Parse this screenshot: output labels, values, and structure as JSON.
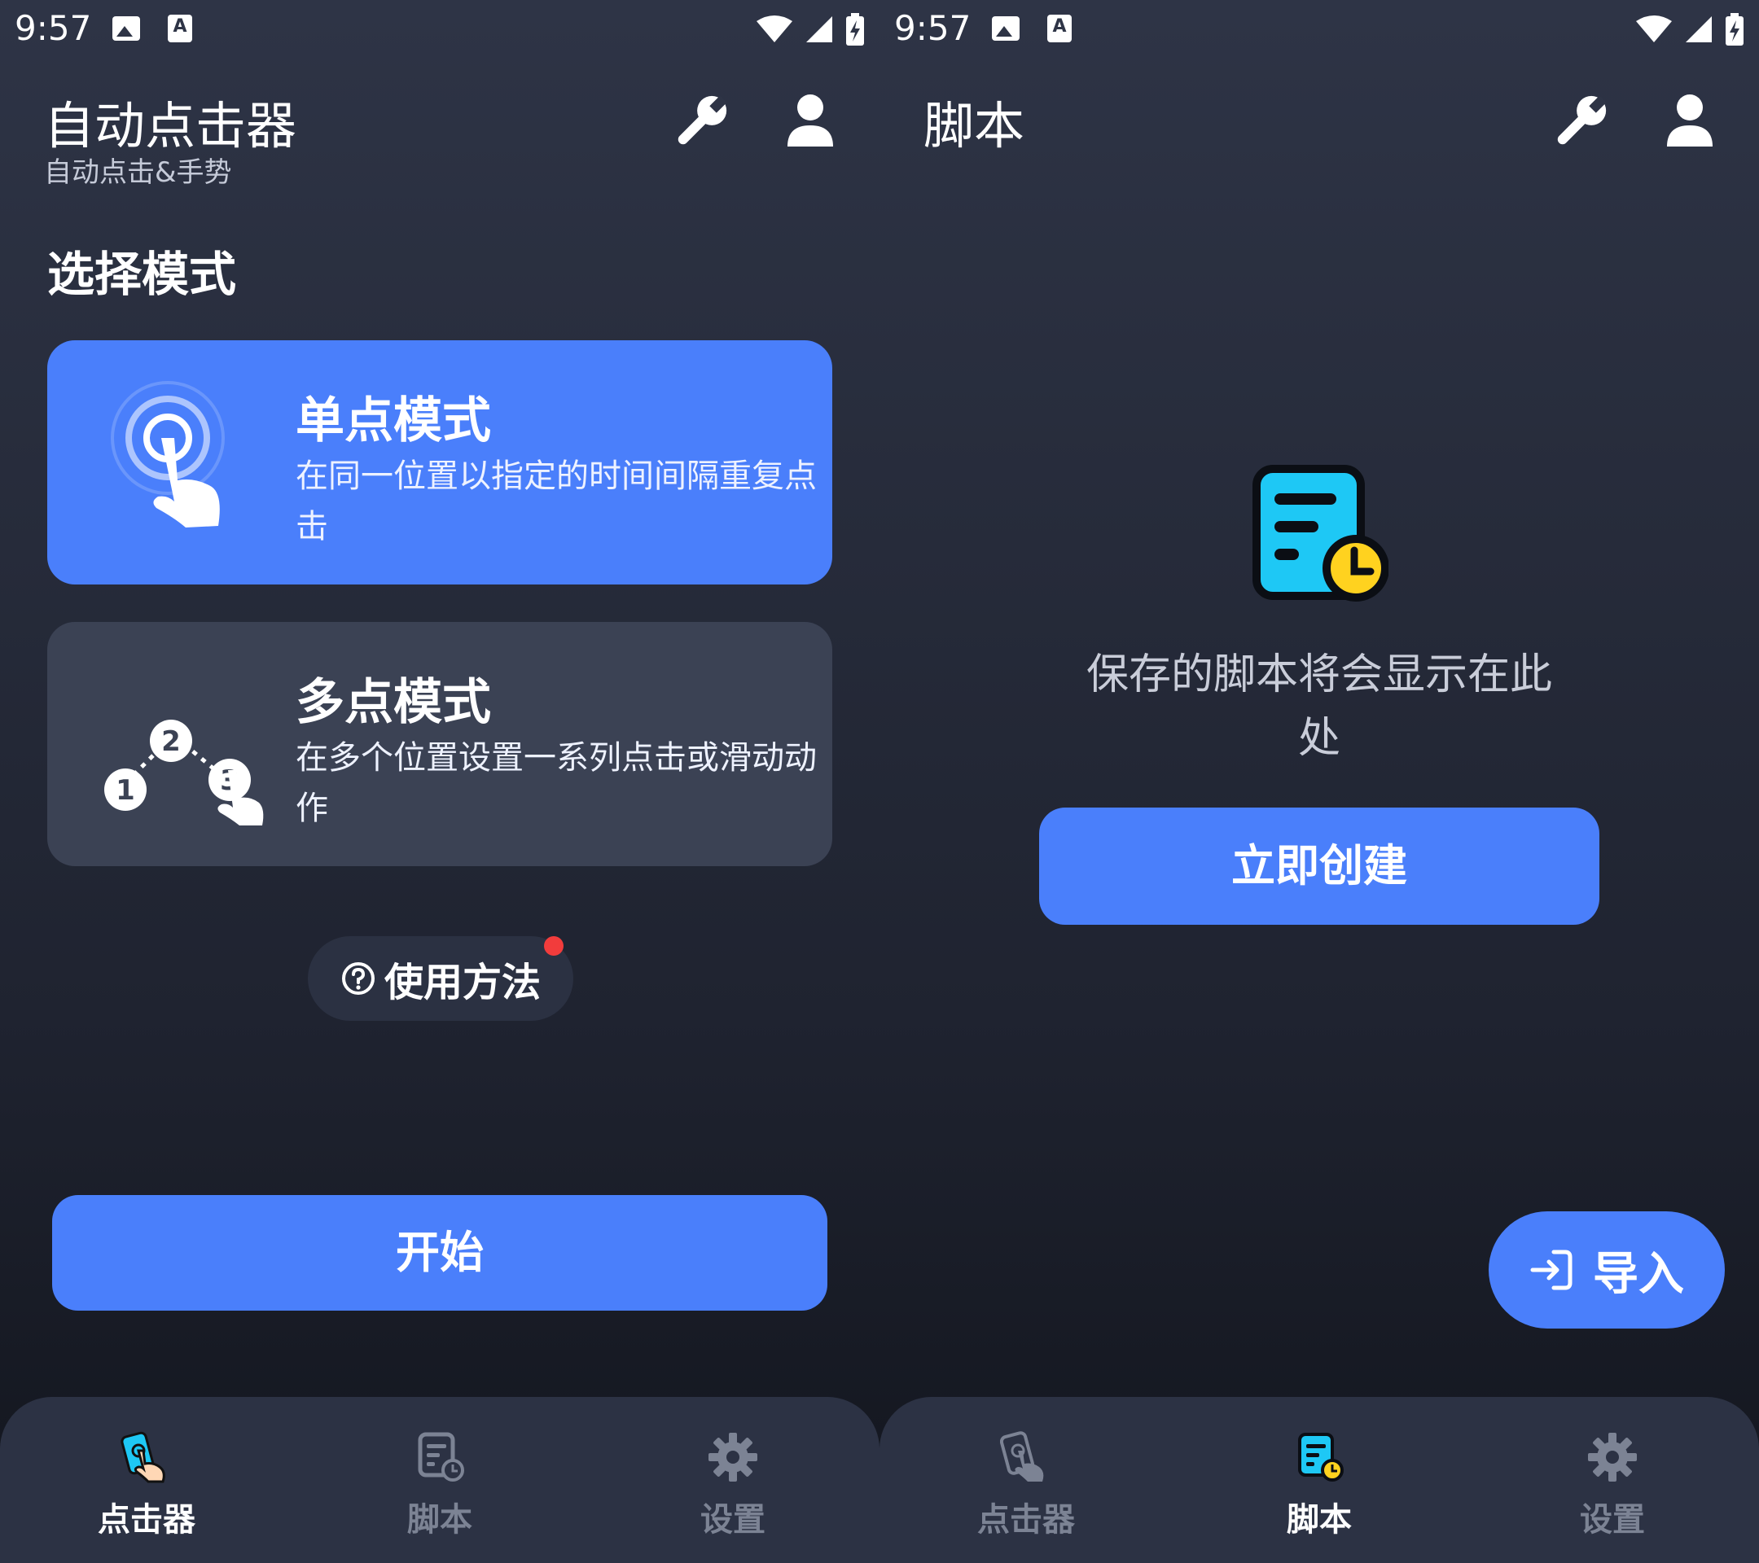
{
  "status_bar": {
    "time": "9:57",
    "notif_letter": "A"
  },
  "left": {
    "app_title": "自动点击器",
    "app_subtitle": "自动点击&手势",
    "section_title": "选择模式",
    "single_mode": {
      "title": "单点模式",
      "description": "在同一位置以指定的时间间隔重复点击"
    },
    "multi_mode": {
      "title": "多点模式",
      "description": "在多个位置设置一系列点击或滑动动作",
      "step_labels": [
        "1",
        "2",
        "3"
      ]
    },
    "howto_label": "使用方法",
    "start_label": "开始",
    "active_tab": "clicker"
  },
  "right": {
    "page_title": "脚本",
    "empty_text": "保存的脚本将会显示在此处",
    "create_label": "立即创建",
    "import_label": "导入",
    "active_tab": "scripts"
  },
  "nav": {
    "clicker": "点击器",
    "scripts": "脚本",
    "settings": "设置"
  },
  "colors": {
    "accent": "#4a7ffb",
    "card_secondary": "#3b4254",
    "nav_bg": "#2c3244",
    "nav_inactive": "#7c8394",
    "notification_dot": "#f23c3c",
    "script_icon_cyan": "#1ec8f5",
    "script_icon_clock": "#ffd21f"
  },
  "icons": {
    "toolbar": [
      "wrench-icon",
      "person-icon"
    ],
    "status": [
      "image-icon",
      "letter-a-icon",
      "wifi-icon",
      "signal-icon",
      "battery-charging-icon"
    ],
    "nav": [
      "clicker-hand-icon",
      "script-doc-icon",
      "gear-icon"
    ]
  }
}
